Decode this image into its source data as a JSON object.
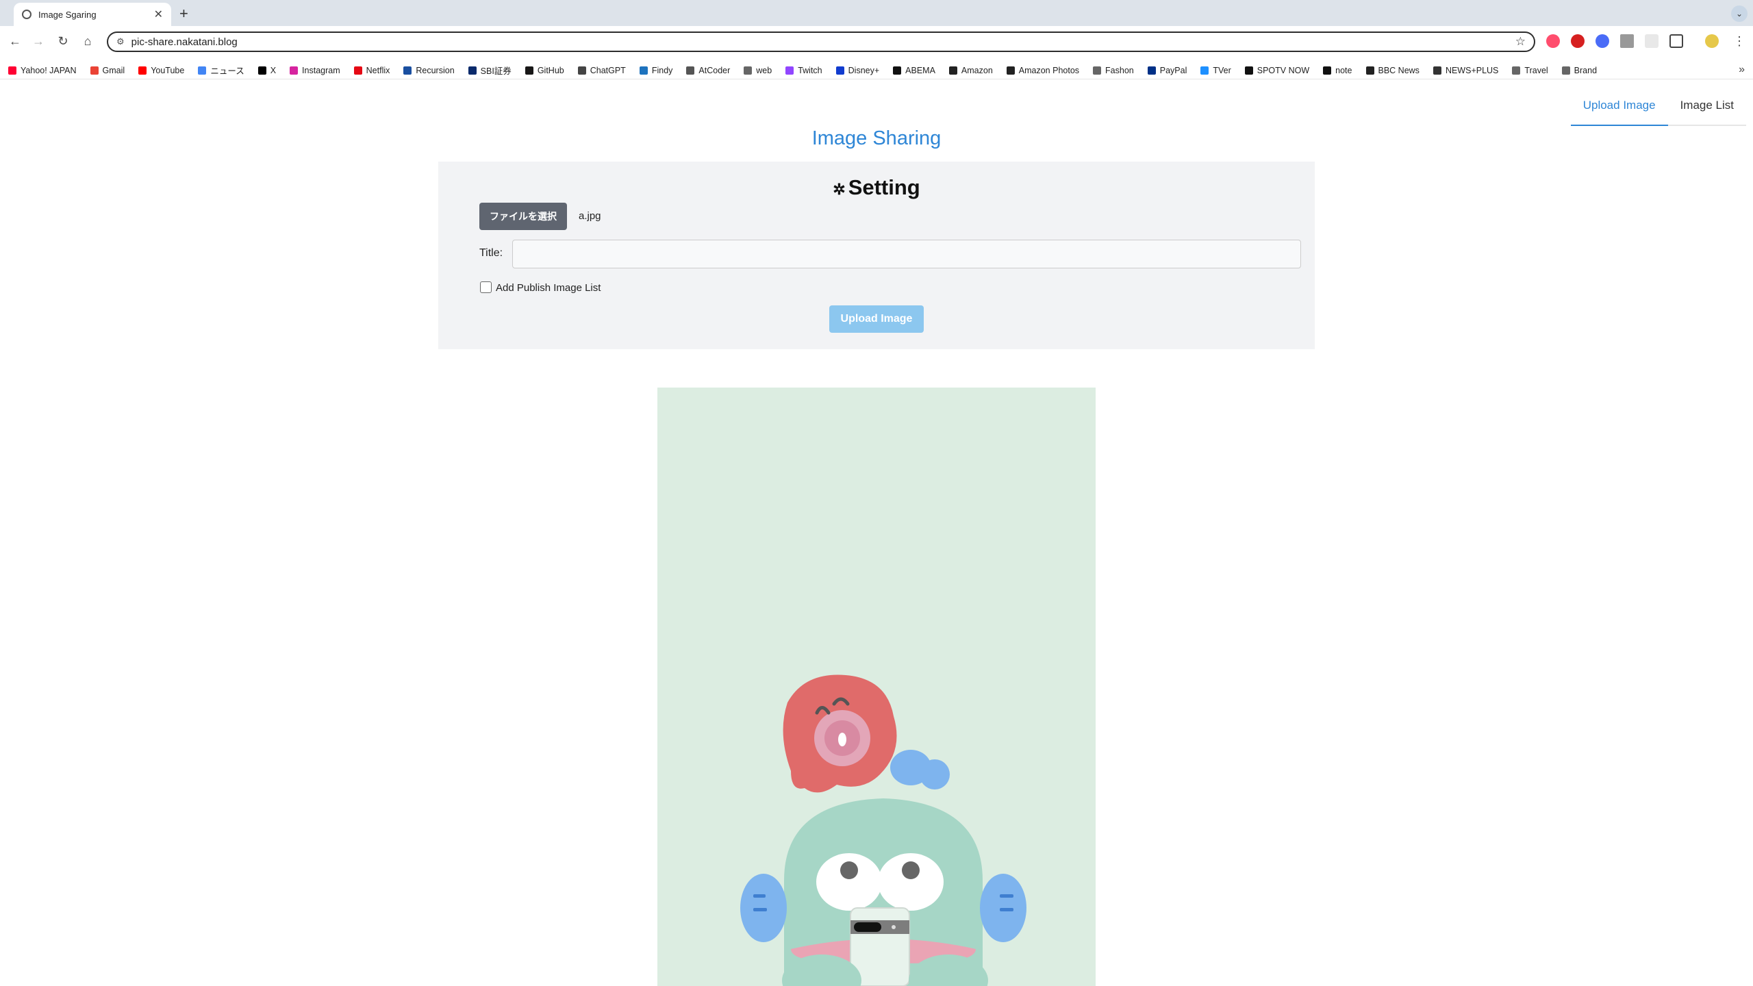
{
  "browser": {
    "tab_title": "Image Sgaring",
    "tab_close": "✕",
    "new_tab": "+",
    "url": "pic-share.nakatani.blog",
    "bookmarks": [
      {
        "label": "Yahoo! JAPAN",
        "color": "#ff0033"
      },
      {
        "label": "Gmail",
        "color": "#ea4335"
      },
      {
        "label": "YouTube",
        "color": "#ff0000"
      },
      {
        "label": "ニュース",
        "color": "#4285f4"
      },
      {
        "label": "X",
        "color": "#000000"
      },
      {
        "label": "Instagram",
        "color": "#d6249f"
      },
      {
        "label": "Netflix",
        "color": "#e50914"
      },
      {
        "label": "Recursion",
        "color": "#1a4fa0"
      },
      {
        "label": "SBI証券",
        "color": "#0a2a6b"
      },
      {
        "label": "GitHub",
        "color": "#181717"
      },
      {
        "label": "ChatGPT",
        "color": "#444444"
      },
      {
        "label": "Findy",
        "color": "#1e73be"
      },
      {
        "label": "AtCoder",
        "color": "#555555"
      },
      {
        "label": "web",
        "color": "#666666"
      },
      {
        "label": "Twitch",
        "color": "#9146ff"
      },
      {
        "label": "Disney+",
        "color": "#113ccf"
      },
      {
        "label": "ABEMA",
        "color": "#111111"
      },
      {
        "label": "Amazon",
        "color": "#222222"
      },
      {
        "label": "Amazon Photos",
        "color": "#222222"
      },
      {
        "label": "Fashon",
        "color": "#666666"
      },
      {
        "label": "PayPal",
        "color": "#003087"
      },
      {
        "label": "TVer",
        "color": "#1e90ff"
      },
      {
        "label": "SPOTV NOW",
        "color": "#111111"
      },
      {
        "label": "note",
        "color": "#111111"
      },
      {
        "label": "BBC News",
        "color": "#222222"
      },
      {
        "label": "NEWS+PLUS",
        "color": "#333333"
      },
      {
        "label": "Travel",
        "color": "#666666"
      },
      {
        "label": "Brand",
        "color": "#666666"
      }
    ],
    "more": "»"
  },
  "nav": {
    "upload": "Upload Image",
    "list": "Image List"
  },
  "app_title": "Image Sharing",
  "setting": {
    "heading": "Setting",
    "file_button": "ファイルを選択",
    "file_name": "a.jpg",
    "title_label": "Title:",
    "title_value": "",
    "publish_label": "Add Publish Image List",
    "publish_checked": false,
    "upload_button": "Upload Image"
  },
  "colors": {
    "accent": "#2e86d6",
    "upload_button": "#8cc7ef",
    "file_button": "#5f6570",
    "preview_bg": "#dcede1"
  }
}
